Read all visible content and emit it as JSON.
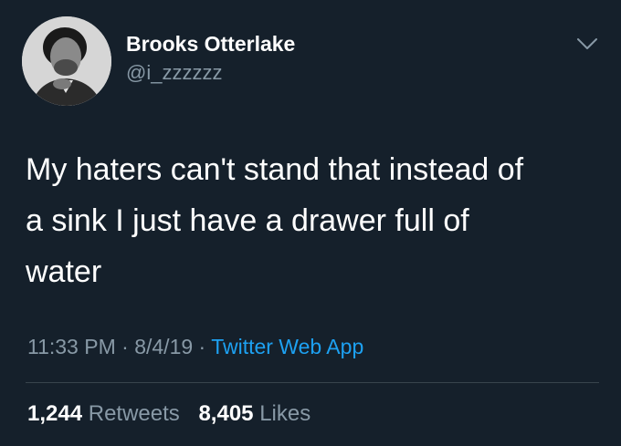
{
  "user": {
    "display_name": "Brooks Otterlake",
    "handle": "@i_zzzzzz"
  },
  "tweet": {
    "text": "My haters can't stand that instead of\na sink I just have a drawer full of\nwater"
  },
  "meta": {
    "time": "11:33 PM",
    "separator": " · ",
    "date": "8/4/19",
    "source": "Twitter Web App"
  },
  "stats": {
    "retweets_count": "1,244",
    "retweets_label": "Retweets",
    "likes_count": "8,405",
    "likes_label": "Likes"
  },
  "icons": {
    "menu": "chevron-down-icon",
    "avatar": "avatar"
  },
  "colors": {
    "background": "#15202b",
    "secondary_text": "#8899a6",
    "link": "#1da1f2"
  }
}
